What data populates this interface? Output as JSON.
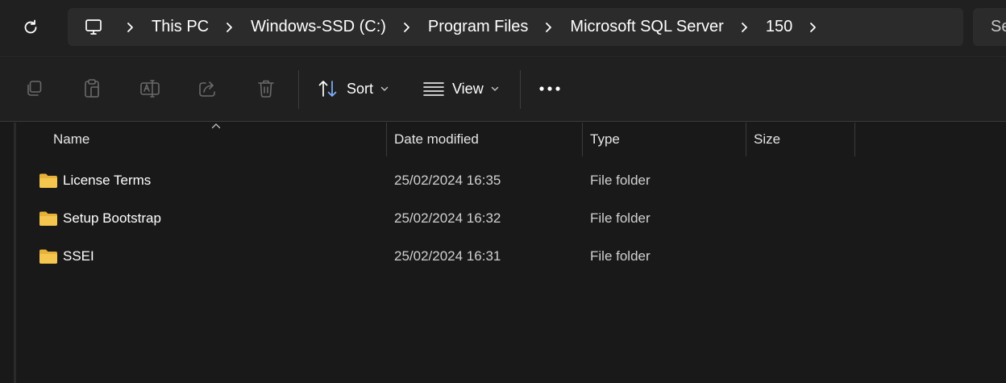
{
  "address_bar": {
    "breadcrumbs": [
      {
        "label": "This PC"
      },
      {
        "label": "Windows-SSD (C:)"
      },
      {
        "label": "Program Files"
      },
      {
        "label": "Microsoft SQL Server"
      },
      {
        "label": "150"
      }
    ],
    "search_placeholder": "Se"
  },
  "command_bar": {
    "sort_label": "Sort",
    "view_label": "View",
    "more_label": "•••"
  },
  "columns": {
    "name": "Name",
    "date_modified": "Date modified",
    "type": "Type",
    "size": "Size"
  },
  "files": [
    {
      "name": "License Terms",
      "date_modified": "25/02/2024 16:35",
      "type": "File folder",
      "size": ""
    },
    {
      "name": "Setup Bootstrap",
      "date_modified": "25/02/2024 16:32",
      "type": "File folder",
      "size": ""
    },
    {
      "name": "SSEI",
      "date_modified": "25/02/2024 16:31",
      "type": "File folder",
      "size": ""
    }
  ],
  "colors": {
    "background": "#191919",
    "toolbar": "#202020",
    "address_box": "#2b2b2b",
    "folder_yellow": "#f4c64f",
    "disabled_icon": "#6a6a6a"
  }
}
